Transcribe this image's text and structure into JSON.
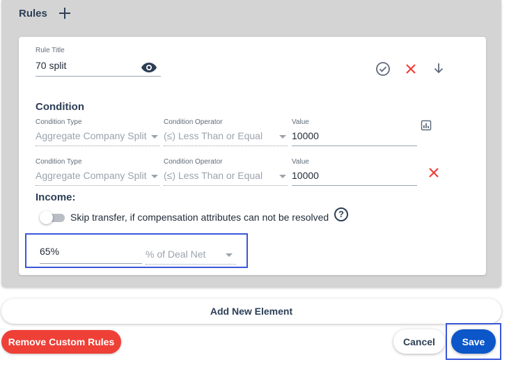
{
  "rules": {
    "title": "Rules",
    "add_icon": "plus-icon"
  },
  "rule": {
    "title_label": "Rule Title",
    "title_value": "70 split",
    "icons": [
      "eye-icon",
      "check-circle-icon",
      "close-icon",
      "arrow-down-icon"
    ]
  },
  "condition": {
    "heading": "Condition",
    "rows": [
      {
        "type_label": "Condition Type",
        "type_value": "Aggregate Company Split",
        "operator_label": "Condition Operator",
        "operator_value": "(≤) Less Than or Equal",
        "value_label": "Value",
        "value": "10000",
        "action_icon": "bar-chart-icon"
      },
      {
        "type_label": "Condition Type",
        "type_value": "Aggregate Company Split",
        "operator_label": "Condition Operator",
        "operator_value": "(≤) Less Than or Equal",
        "value_label": "Value",
        "value": "10000",
        "action_icon": "close-icon"
      }
    ]
  },
  "income": {
    "heading": "Income:",
    "skip_label": "Skip transfer, if compensation attributes can not be resolved",
    "skip_enabled": false,
    "percent_value": "65%",
    "basis_value": "% of Deal Net"
  },
  "footer": {
    "add_element": "Add New Element",
    "remove_custom_rules": "Remove Custom Rules",
    "cancel": "Cancel",
    "save": "Save"
  },
  "colors": {
    "accent": "#0b56c9",
    "danger": "#ee4037",
    "highlight": "#3b56d9",
    "text_dark": "#2d3e56"
  }
}
